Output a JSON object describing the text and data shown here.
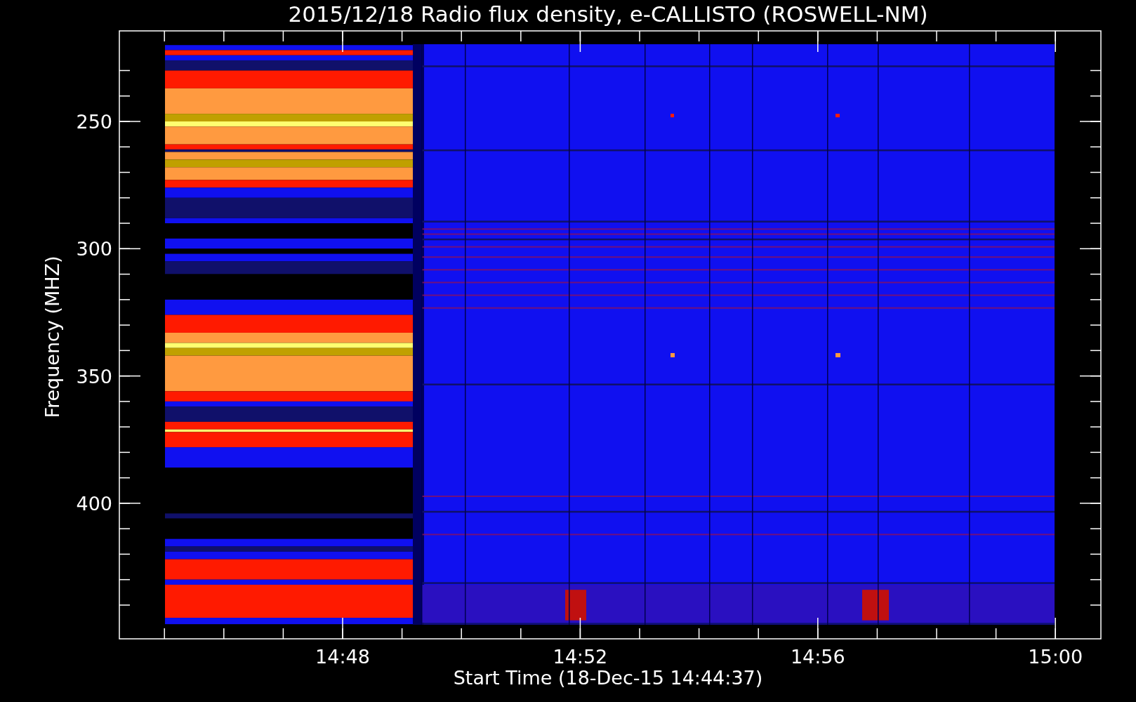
{
  "title": "2015/12/18  Radio flux density, e-CALLISTO (ROSWELL-NM)",
  "y_axis": {
    "label": "Frequency (MHZ)",
    "ticks": [
      "250",
      "300",
      "350",
      "400"
    ]
  },
  "x_axis": {
    "label": "Start Time (18-Dec-15 14:44:37)",
    "ticks": [
      "14:48",
      "14:52",
      "14:56",
      "15:00"
    ]
  }
}
